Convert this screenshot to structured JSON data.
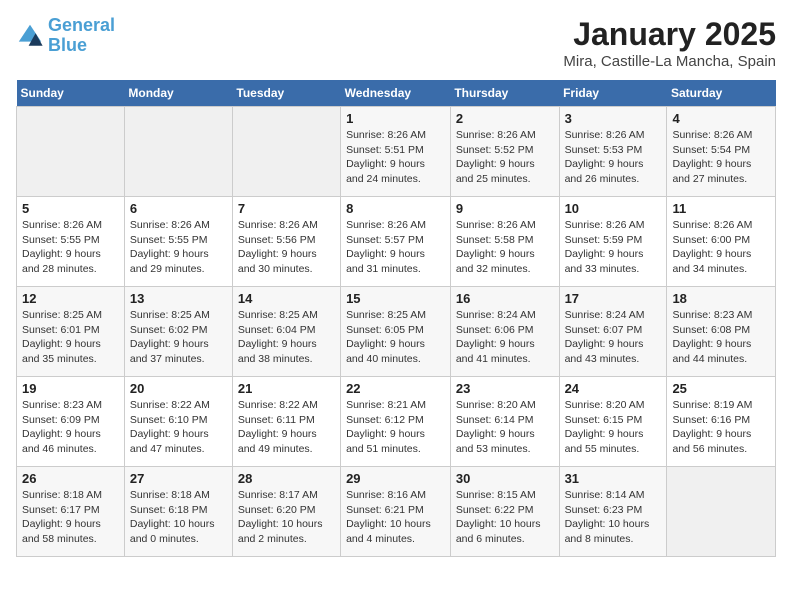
{
  "logo": {
    "text_general": "General",
    "text_blue": "Blue"
  },
  "header": {
    "title": "January 2025",
    "subtitle": "Mira, Castille-La Mancha, Spain"
  },
  "columns": [
    "Sunday",
    "Monday",
    "Tuesday",
    "Wednesday",
    "Thursday",
    "Friday",
    "Saturday"
  ],
  "weeks": [
    {
      "days": [
        {
          "num": "",
          "info": ""
        },
        {
          "num": "",
          "info": ""
        },
        {
          "num": "",
          "info": ""
        },
        {
          "num": "1",
          "info": "Sunrise: 8:26 AM\nSunset: 5:51 PM\nDaylight: 9 hours\nand 24 minutes."
        },
        {
          "num": "2",
          "info": "Sunrise: 8:26 AM\nSunset: 5:52 PM\nDaylight: 9 hours\nand 25 minutes."
        },
        {
          "num": "3",
          "info": "Sunrise: 8:26 AM\nSunset: 5:53 PM\nDaylight: 9 hours\nand 26 minutes."
        },
        {
          "num": "4",
          "info": "Sunrise: 8:26 AM\nSunset: 5:54 PM\nDaylight: 9 hours\nand 27 minutes."
        }
      ]
    },
    {
      "days": [
        {
          "num": "5",
          "info": "Sunrise: 8:26 AM\nSunset: 5:55 PM\nDaylight: 9 hours\nand 28 minutes."
        },
        {
          "num": "6",
          "info": "Sunrise: 8:26 AM\nSunset: 5:55 PM\nDaylight: 9 hours\nand 29 minutes."
        },
        {
          "num": "7",
          "info": "Sunrise: 8:26 AM\nSunset: 5:56 PM\nDaylight: 9 hours\nand 30 minutes."
        },
        {
          "num": "8",
          "info": "Sunrise: 8:26 AM\nSunset: 5:57 PM\nDaylight: 9 hours\nand 31 minutes."
        },
        {
          "num": "9",
          "info": "Sunrise: 8:26 AM\nSunset: 5:58 PM\nDaylight: 9 hours\nand 32 minutes."
        },
        {
          "num": "10",
          "info": "Sunrise: 8:26 AM\nSunset: 5:59 PM\nDaylight: 9 hours\nand 33 minutes."
        },
        {
          "num": "11",
          "info": "Sunrise: 8:26 AM\nSunset: 6:00 PM\nDaylight: 9 hours\nand 34 minutes."
        }
      ]
    },
    {
      "days": [
        {
          "num": "12",
          "info": "Sunrise: 8:25 AM\nSunset: 6:01 PM\nDaylight: 9 hours\nand 35 minutes."
        },
        {
          "num": "13",
          "info": "Sunrise: 8:25 AM\nSunset: 6:02 PM\nDaylight: 9 hours\nand 37 minutes."
        },
        {
          "num": "14",
          "info": "Sunrise: 8:25 AM\nSunset: 6:04 PM\nDaylight: 9 hours\nand 38 minutes."
        },
        {
          "num": "15",
          "info": "Sunrise: 8:25 AM\nSunset: 6:05 PM\nDaylight: 9 hours\nand 40 minutes."
        },
        {
          "num": "16",
          "info": "Sunrise: 8:24 AM\nSunset: 6:06 PM\nDaylight: 9 hours\nand 41 minutes."
        },
        {
          "num": "17",
          "info": "Sunrise: 8:24 AM\nSunset: 6:07 PM\nDaylight: 9 hours\nand 43 minutes."
        },
        {
          "num": "18",
          "info": "Sunrise: 8:23 AM\nSunset: 6:08 PM\nDaylight: 9 hours\nand 44 minutes."
        }
      ]
    },
    {
      "days": [
        {
          "num": "19",
          "info": "Sunrise: 8:23 AM\nSunset: 6:09 PM\nDaylight: 9 hours\nand 46 minutes."
        },
        {
          "num": "20",
          "info": "Sunrise: 8:22 AM\nSunset: 6:10 PM\nDaylight: 9 hours\nand 47 minutes."
        },
        {
          "num": "21",
          "info": "Sunrise: 8:22 AM\nSunset: 6:11 PM\nDaylight: 9 hours\nand 49 minutes."
        },
        {
          "num": "22",
          "info": "Sunrise: 8:21 AM\nSunset: 6:12 PM\nDaylight: 9 hours\nand 51 minutes."
        },
        {
          "num": "23",
          "info": "Sunrise: 8:20 AM\nSunset: 6:14 PM\nDaylight: 9 hours\nand 53 minutes."
        },
        {
          "num": "24",
          "info": "Sunrise: 8:20 AM\nSunset: 6:15 PM\nDaylight: 9 hours\nand 55 minutes."
        },
        {
          "num": "25",
          "info": "Sunrise: 8:19 AM\nSunset: 6:16 PM\nDaylight: 9 hours\nand 56 minutes."
        }
      ]
    },
    {
      "days": [
        {
          "num": "26",
          "info": "Sunrise: 8:18 AM\nSunset: 6:17 PM\nDaylight: 9 hours\nand 58 minutes."
        },
        {
          "num": "27",
          "info": "Sunrise: 8:18 AM\nSunset: 6:18 PM\nDaylight: 10 hours\nand 0 minutes."
        },
        {
          "num": "28",
          "info": "Sunrise: 8:17 AM\nSunset: 6:20 PM\nDaylight: 10 hours\nand 2 minutes."
        },
        {
          "num": "29",
          "info": "Sunrise: 8:16 AM\nSunset: 6:21 PM\nDaylight: 10 hours\nand 4 minutes."
        },
        {
          "num": "30",
          "info": "Sunrise: 8:15 AM\nSunset: 6:22 PM\nDaylight: 10 hours\nand 6 minutes."
        },
        {
          "num": "31",
          "info": "Sunrise: 8:14 AM\nSunset: 6:23 PM\nDaylight: 10 hours\nand 8 minutes."
        },
        {
          "num": "",
          "info": ""
        }
      ]
    }
  ]
}
